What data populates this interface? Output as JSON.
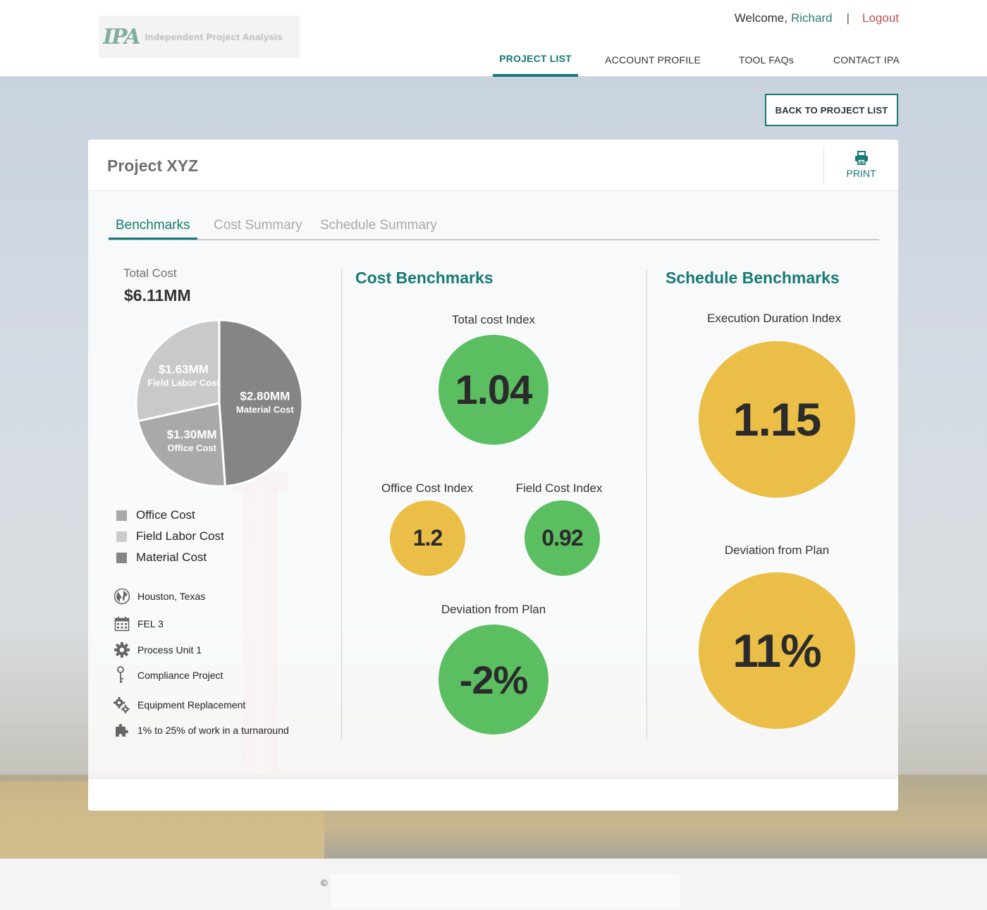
{
  "header": {
    "logo_text": "Independent Project Analysis",
    "welcome": "Welcome,",
    "user_name": "Richard",
    "separator": "|",
    "logout": "Logout",
    "nav": [
      "PROJECT LIST",
      "ACCOUNT PROFILE",
      "TOOL FAQs",
      "CONTACT IPA"
    ]
  },
  "back_button": "BACK TO PROJECT LIST",
  "project": {
    "title": "Project XYZ",
    "print_label": "PRINT"
  },
  "tabs": [
    "Benchmarks",
    "Cost Summary",
    "Schedule Summary"
  ],
  "total_cost": {
    "label": "Total Cost",
    "value": "$6.11MM"
  },
  "chart_data": {
    "type": "pie",
    "categories": [
      "Material Cost",
      "Office Cost",
      "Field Labor Cost"
    ],
    "values": [
      2.8,
      1.3,
      1.63
    ],
    "value_labels": [
      "$2.80MM",
      "$1.30MM",
      "$1.63MM"
    ],
    "colors": [
      "#858585",
      "#a9a9a9",
      "#c9c9c9"
    ]
  },
  "legend": [
    {
      "label": "Office Cost",
      "color": "#a9a9a9"
    },
    {
      "label": "Field Labor Cost",
      "color": "#cbcbcb"
    },
    {
      "label": "Material Cost",
      "color": "#858585"
    }
  ],
  "project_info": [
    {
      "icon": "globe-icon",
      "text": "Houston, Texas"
    },
    {
      "icon": "calendar-icon",
      "text": "FEL 3"
    },
    {
      "icon": "gear-icon",
      "text": "Process Unit 1"
    },
    {
      "icon": "key-icon",
      "text": "Compliance Project"
    },
    {
      "icon": "gears-icon",
      "text": "Equipment Replacement"
    },
    {
      "icon": "puzzle-icon",
      "text": "1% to 25% of work in a turnaround"
    }
  ],
  "cost_benchmarks": {
    "title": "Cost Benchmarks",
    "total_index_label": "Total cost Index",
    "total_index_value": "1.04",
    "office_index_label": "Office Cost Index",
    "office_index_value": "1.2",
    "field_index_label": "Field Cost Index",
    "field_index_value": "0.92",
    "deviation_label": "Deviation from Plan",
    "deviation_value": "-2%"
  },
  "schedule_benchmarks": {
    "title": "Schedule Benchmarks",
    "duration_label": "Execution Duration Index",
    "duration_value": "1.15",
    "deviation_label": "Deviation from Plan",
    "deviation_value": "11%"
  },
  "colors": {
    "accent": "#177a74",
    "good": "#5bbf62",
    "warn": "#ebbe47",
    "logout": "#c0504d"
  },
  "footer": {
    "copyright": "©"
  }
}
